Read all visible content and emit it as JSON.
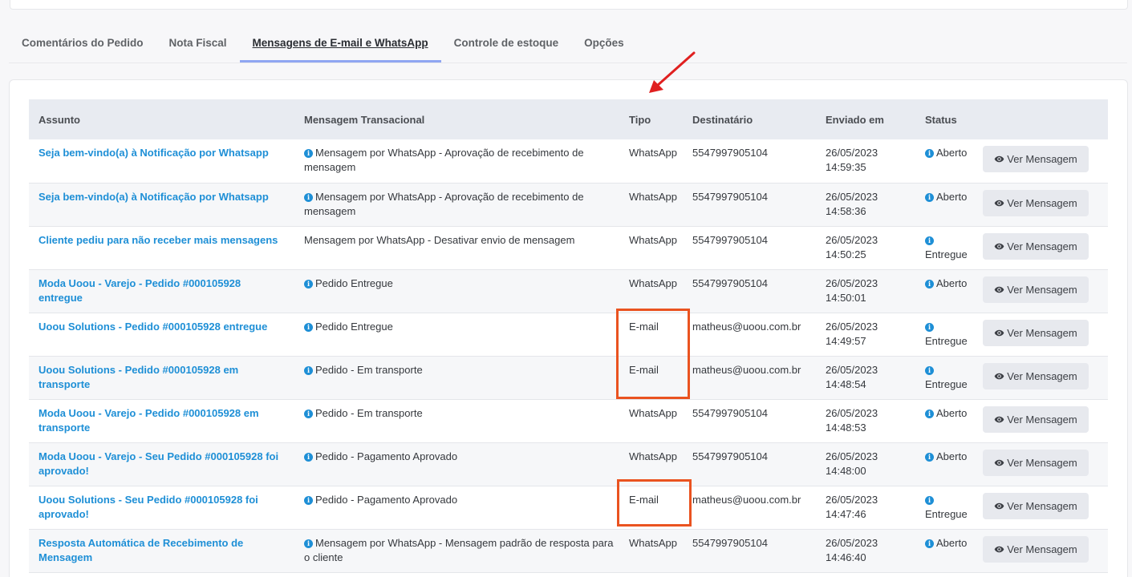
{
  "tabs": [
    {
      "label": "Comentários do Pedido"
    },
    {
      "label": "Nota Fiscal"
    },
    {
      "label": "Mensagens de E-mail e WhatsApp"
    },
    {
      "label": "Controle de estoque"
    },
    {
      "label": "Opções"
    }
  ],
  "active_tab": 2,
  "table": {
    "headers": {
      "subject": "Assunto",
      "message": "Mensagem Transacional",
      "type": "Tipo",
      "recipient": "Destinatário",
      "sent": "Enviado em",
      "status": "Status"
    },
    "button_label": "Ver Mensagem",
    "rows": [
      {
        "subject": "Seja bem-vindo(a) à Notificação por Whatsapp",
        "message_icon": true,
        "message": "Mensagem por WhatsApp - Aprovação de recebimento de mensagem",
        "type": "WhatsApp",
        "recipient": "5547997905104",
        "date": "26/05/2023",
        "time": "14:59:35",
        "status": "Aberto"
      },
      {
        "subject": "Seja bem-vindo(a) à Notificação por Whatsapp",
        "message_icon": true,
        "message": "Mensagem por WhatsApp - Aprovação de recebimento de mensagem",
        "type": "WhatsApp",
        "recipient": "5547997905104",
        "date": "26/05/2023",
        "time": "14:58:36",
        "status": "Aberto"
      },
      {
        "subject": "Cliente pediu para não receber mais mensagens",
        "message_icon": false,
        "message": "Mensagem por WhatsApp - Desativar envio de mensagem",
        "type": "WhatsApp",
        "recipient": "5547997905104",
        "date": "26/05/2023",
        "time": "14:50:25",
        "status": "Entregue"
      },
      {
        "subject": "Moda Uoou - Varejo - Pedido #000105928 entregue",
        "message_icon": true,
        "message": "Pedido Entregue",
        "type": "WhatsApp",
        "recipient": "5547997905104",
        "date": "26/05/2023",
        "time": "14:50:01",
        "status": "Aberto"
      },
      {
        "subject": "Uoou Solutions - Pedido #000105928 entregue",
        "message_icon": true,
        "message": "Pedido Entregue",
        "type": "E-mail",
        "recipient": "matheus@uoou.com.br",
        "date": "26/05/2023",
        "time": "14:49:57",
        "status": "Entregue"
      },
      {
        "subject": "Uoou Solutions - Pedido #000105928 em transporte",
        "message_icon": true,
        "message": "Pedido - Em transporte",
        "type": "E-mail",
        "recipient": "matheus@uoou.com.br",
        "date": "26/05/2023",
        "time": "14:48:54",
        "status": "Entregue"
      },
      {
        "subject": "Moda Uoou - Varejo - Pedido #000105928 em transporte",
        "message_icon": true,
        "message": "Pedido - Em transporte",
        "type": "WhatsApp",
        "recipient": "5547997905104",
        "date": "26/05/2023",
        "time": "14:48:53",
        "status": "Aberto"
      },
      {
        "subject": "Moda Uoou - Varejo - Seu Pedido #000105928 foi aprovado!",
        "message_icon": true,
        "message": "Pedido - Pagamento Aprovado",
        "type": "WhatsApp",
        "recipient": "5547997905104",
        "date": "26/05/2023",
        "time": "14:48:00",
        "status": "Aberto"
      },
      {
        "subject": "Uoou Solutions - Seu Pedido #000105928 foi aprovado!",
        "message_icon": true,
        "message": "Pedido - Pagamento Aprovado",
        "type": "E-mail",
        "recipient": "matheus@uoou.com.br",
        "date": "26/05/2023",
        "time": "14:47:46",
        "status": "Entregue"
      },
      {
        "subject": "Resposta Automática de Recebimento de Mensagem",
        "message_icon": true,
        "message": "Mensagem por WhatsApp - Mensagem padrão de resposta para o cliente",
        "type": "WhatsApp",
        "recipient": "5547997905104",
        "date": "26/05/2023",
        "time": "14:46:40",
        "status": "Aberto"
      }
    ]
  },
  "icons": {
    "info": "info-circle-icon",
    "button": "eye-icon"
  },
  "colors": {
    "link": "#1e8fd6",
    "highlight": "#ea5320",
    "arrow": "#e02020",
    "active_tab_underline": "#8fa6f2"
  }
}
